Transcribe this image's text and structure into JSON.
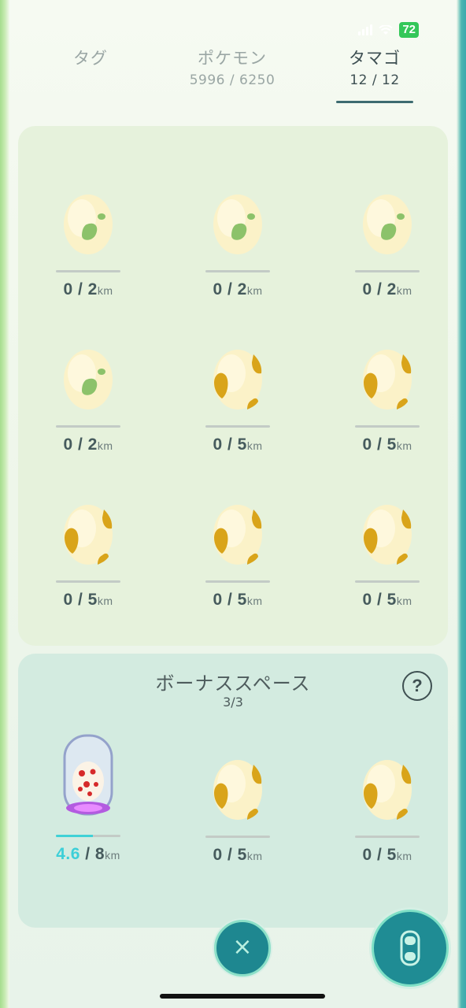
{
  "status_bar": {
    "battery": "72"
  },
  "tabs": [
    {
      "label": "タグ",
      "count": ""
    },
    {
      "label": "ポケモン",
      "count": "5996 / 6250"
    },
    {
      "label": "タマゴ",
      "count": "12 / 12"
    }
  ],
  "eggs": [
    {
      "current": "0",
      "total": "2",
      "unit": "km",
      "type": "green"
    },
    {
      "current": "0",
      "total": "2",
      "unit": "km",
      "type": "green"
    },
    {
      "current": "0",
      "total": "2",
      "unit": "km",
      "type": "green"
    },
    {
      "current": "0",
      "total": "2",
      "unit": "km",
      "type": "green"
    },
    {
      "current": "0",
      "total": "5",
      "unit": "km",
      "type": "yellow"
    },
    {
      "current": "0",
      "total": "5",
      "unit": "km",
      "type": "yellow"
    },
    {
      "current": "0",
      "total": "5",
      "unit": "km",
      "type": "yellow"
    },
    {
      "current": "0",
      "total": "5",
      "unit": "km",
      "type": "yellow"
    },
    {
      "current": "0",
      "total": "5",
      "unit": "km",
      "type": "yellow"
    }
  ],
  "bonus": {
    "title": "ボーナススペース",
    "count": "3/3",
    "help": "?",
    "eggs": [
      {
        "current": "4.6",
        "total": "8",
        "unit": "km",
        "type": "red-incubating",
        "progress": 0.575
      },
      {
        "current": "0",
        "total": "5",
        "unit": "km",
        "type": "yellow"
      },
      {
        "current": "0",
        "total": "5",
        "unit": "km",
        "type": "yellow"
      }
    ]
  },
  "buttons": {
    "close": "×"
  },
  "colors": {
    "accent": "#1f8c94",
    "progress": "#3fd1d6",
    "egg_green_spot": "#8cc26a",
    "egg_yellow_spot": "#d9a41a",
    "egg_red_spot": "#d62a2a"
  }
}
